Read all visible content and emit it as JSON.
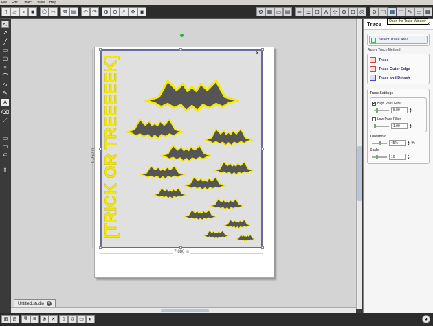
{
  "menu": [
    "File",
    "Edit",
    "Object",
    "View",
    "Help"
  ],
  "tooltip": "Open the Trace Window",
  "doc_tab": {
    "name": "Untitled.studio",
    "close": "✕"
  },
  "canvas": {
    "vertical_text": "[TRICK OR TREEEEEK]",
    "width_label": "7.880 in",
    "height_label": "9.960 in",
    "close_label": "✕"
  },
  "colors": {
    "accent_yellow": "#f4ea00",
    "bat_fill": "#555555",
    "trace_border": "#6a6a9a"
  },
  "panel": {
    "title": "Trace",
    "close_label": "✕",
    "select_area_label": "Select Trace Area",
    "apply_method_title": "Apply Trace Method",
    "methods": [
      "Trace",
      "Trace Outer Edge",
      "Trace and Detach"
    ],
    "settings_title": "Trace Settings",
    "high_pass": {
      "label": "High Pass Filter",
      "checked": "✔",
      "value": "5.00"
    },
    "low_pass": {
      "label": "Low Pass Filter",
      "checked": "",
      "value": "1.00"
    },
    "threshold": {
      "label": "Threshold",
      "value": "45%",
      "unit": "%"
    },
    "scale": {
      "label": "Scale",
      "value": "10"
    }
  }
}
